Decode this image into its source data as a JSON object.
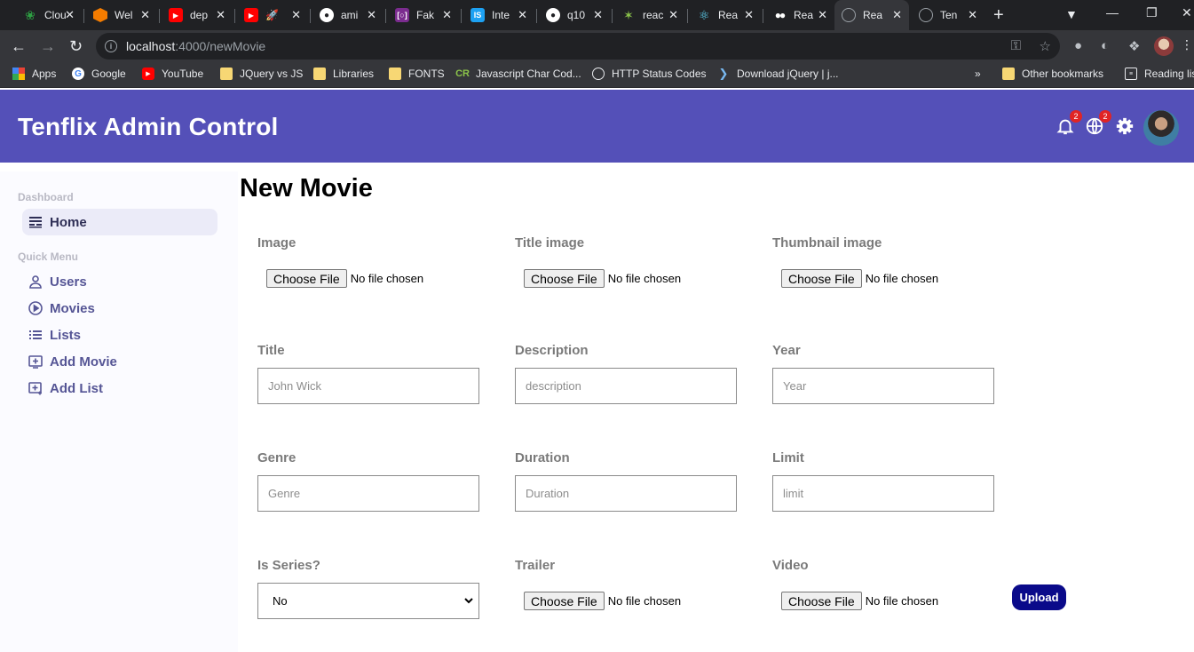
{
  "browser": {
    "tabs": [
      {
        "label": "Clou",
        "icon": "leaf-icon",
        "color": "#2ea043"
      },
      {
        "label": "Wel",
        "icon": "hexagon-icon",
        "color": "#f57c00"
      },
      {
        "label": "dep",
        "icon": "youtube-icon",
        "color": "#ff0000"
      },
      {
        "label": "🚀",
        "icon": "youtube-icon",
        "color": "#ff0000"
      },
      {
        "label": "ami",
        "icon": "github-icon",
        "color": "#ffffff"
      },
      {
        "label": "Fak",
        "icon": "fake-icon",
        "color": "#7b2c8f"
      },
      {
        "label": "Inte",
        "icon": "is-icon",
        "color": "#1da1f2"
      },
      {
        "label": "q10",
        "icon": "github-icon",
        "color": "#ffffff"
      },
      {
        "label": "reac",
        "icon": "spark-icon",
        "color": "#8bc34a"
      },
      {
        "label": "Rea",
        "icon": "react-icon",
        "color": "#61dafb"
      },
      {
        "label": "Rea",
        "icon": "medium-icon",
        "color": "#ffffff"
      },
      {
        "label": "Rea",
        "icon": "globe-icon",
        "color": "#9aa0a6"
      },
      {
        "label": "Ten",
        "icon": "globe-icon",
        "color": "#9aa0a6"
      }
    ],
    "url_host": "localhost",
    "url_path": ":4000/newMovie",
    "bookmarks": [
      {
        "label": "Apps"
      },
      {
        "label": "Google"
      },
      {
        "label": "YouTube"
      },
      {
        "label": "JQuery vs JS"
      },
      {
        "label": "Libraries"
      },
      {
        "label": "FONTS"
      },
      {
        "label": "Javascript Char Cod..."
      },
      {
        "label": "HTTP Status Codes"
      },
      {
        "label": "Download jQuery | j..."
      },
      {
        "label": "Other bookmarks"
      },
      {
        "label": "Reading list"
      }
    ]
  },
  "app": {
    "brand": "Tenflix Admin Control",
    "notifications_badge": "2",
    "language_badge": "2"
  },
  "sidebar": {
    "sections": [
      {
        "title": "Dashboard"
      },
      {
        "title": "Quick Menu"
      }
    ],
    "items": [
      {
        "label": "Home",
        "icon": "home-icon"
      },
      {
        "label": "Users",
        "icon": "user-icon"
      },
      {
        "label": "Movies",
        "icon": "play-circle-icon"
      },
      {
        "label": "Lists",
        "icon": "list-icon"
      },
      {
        "label": "Add Movie",
        "icon": "add-box-icon"
      },
      {
        "label": "Add List",
        "icon": "add-list-icon"
      }
    ]
  },
  "form": {
    "title": "New Movie",
    "choose_file_label": "Choose File",
    "no_file_text": "No file chosen",
    "image_label": "Image",
    "title_image_label": "Title image",
    "thumbnail_label": "Thumbnail image",
    "title_label": "Title",
    "title_placeholder": "John Wick",
    "description_label": "Description",
    "description_placeholder": "description",
    "year_label": "Year",
    "year_placeholder": "Year",
    "genre_label": "Genre",
    "genre_placeholder": "Genre",
    "duration_label": "Duration",
    "duration_placeholder": "Duration",
    "limit_label": "Limit",
    "limit_placeholder": "limit",
    "series_label": "Is Series?",
    "series_value": "No",
    "trailer_label": "Trailer",
    "video_label": "Video",
    "upload_label": "Upload"
  }
}
